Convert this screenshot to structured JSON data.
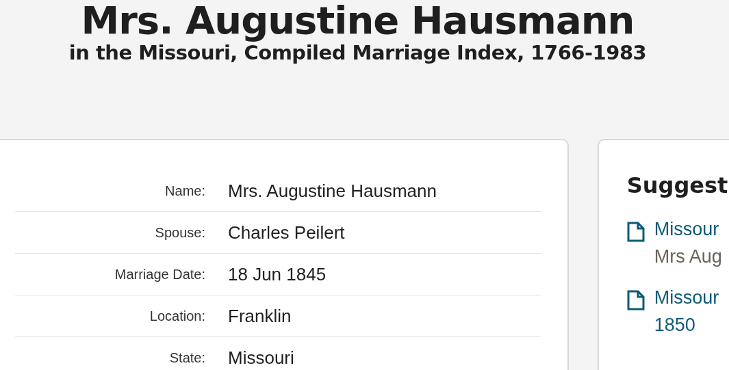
{
  "header": {
    "title": "Mrs. Augustine Hausmann",
    "subtitle": "in the Missouri, Compiled Marriage Index, 1766-1983"
  },
  "record": {
    "fields": [
      {
        "label": "Name:",
        "value": "Mrs. Augustine Hausmann"
      },
      {
        "label": "Spouse:",
        "value": "Charles Peilert"
      },
      {
        "label": "Marriage Date:",
        "value": "18 Jun 1845"
      },
      {
        "label": "Location:",
        "value": "Franklin"
      },
      {
        "label": "State:",
        "value": "Missouri"
      }
    ]
  },
  "suggested": {
    "title": "Suggest",
    "items": [
      {
        "link": [
          "Missour"
        ],
        "detail": "Mrs Aug"
      },
      {
        "link": [
          "Missour",
          "1850"
        ]
      }
    ]
  }
}
